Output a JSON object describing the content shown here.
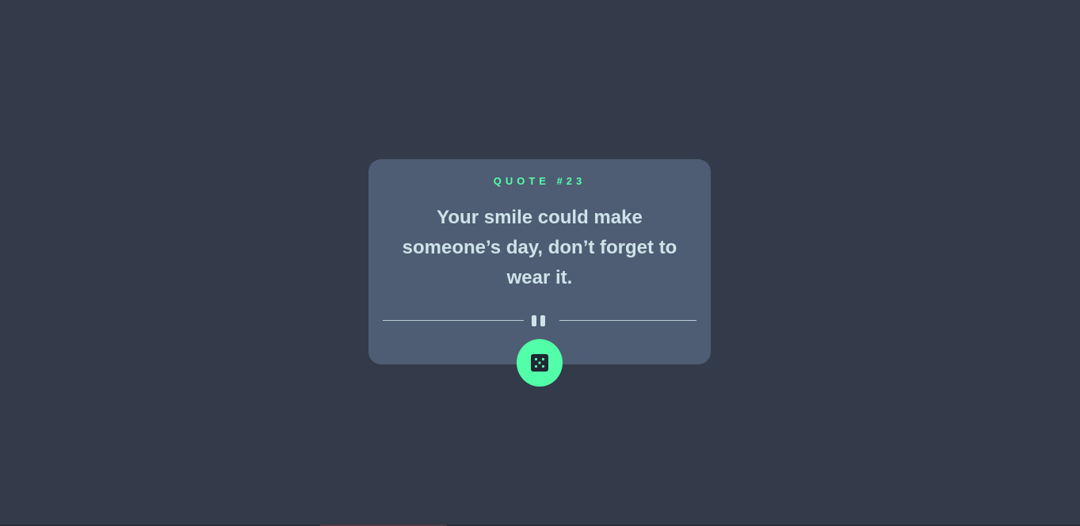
{
  "card": {
    "label": "QUOTE #23",
    "quote": "Your smile could make someone’s day, don’t forget to wear it."
  },
  "divider": {
    "icon": "pause-icon"
  },
  "dice_button": {
    "icon": "dice-icon"
  },
  "colors": {
    "background": "#333a4a",
    "card": "#4e5d73",
    "accent": "#52ffa8",
    "text": "#cee3e9"
  }
}
